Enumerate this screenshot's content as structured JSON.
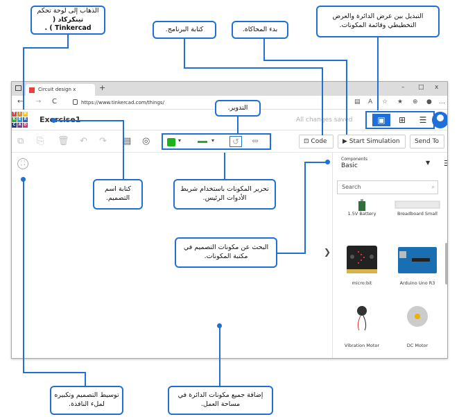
{
  "browser": {
    "tab_title": "Circuit design x",
    "tab_close": "x",
    "new_tab": "+",
    "url": "https://www.tinkercad.com/things/",
    "back": "←",
    "forward": "→",
    "reload": "C",
    "min": "–",
    "max": "□",
    "close": "x"
  },
  "app": {
    "logo_letters": [
      "T",
      "I",
      "N",
      "K",
      "E",
      "R",
      "C",
      "A",
      "D"
    ],
    "title": "Exercise1",
    "save_status": "All changes saved"
  },
  "toolbar": {
    "code_label": "Code",
    "start_sim_label": "Start Simulation",
    "send_to_label": "Send To"
  },
  "panel": {
    "components_label": "Components",
    "components_value": "Basic",
    "search_placeholder": "Search",
    "items": [
      {
        "label": "1.5V Battery"
      },
      {
        "label": "Breadboard Small"
      },
      {
        "label": "micro:bit"
      },
      {
        "label": "Arduino Uno R3"
      },
      {
        "label": "Vibration Motor"
      },
      {
        "label": "DC Motor"
      }
    ]
  },
  "callouts": {
    "dashboard": "الذهاب إلى لوحة تحكم",
    "dashboard_bold": "تينكركاد ( Tinkercad ) .",
    "code": "كتابة البرنامج.",
    "simulate": "بدء المحاكاة.",
    "switch": "التبديل بين عرض الدائرة والعرض التخطيطي وقائمة المكونات.",
    "rotate": "التدوير.",
    "name": "كتابة اسم التصميم.",
    "edit": "تحرير المكونات باستخدام شريط الأدوات الرئيس.",
    "search": "البحث عن مكونات التصميم في مكتبة المكونات.",
    "zoom": "توسيط التصميم وتكبيره لملء النافذة.",
    "add": "إضافة جميع مكونات الدائرة في مساحة العمل."
  },
  "colors": {
    "accent": "#1e6fd9",
    "green": "#1fb01f"
  }
}
